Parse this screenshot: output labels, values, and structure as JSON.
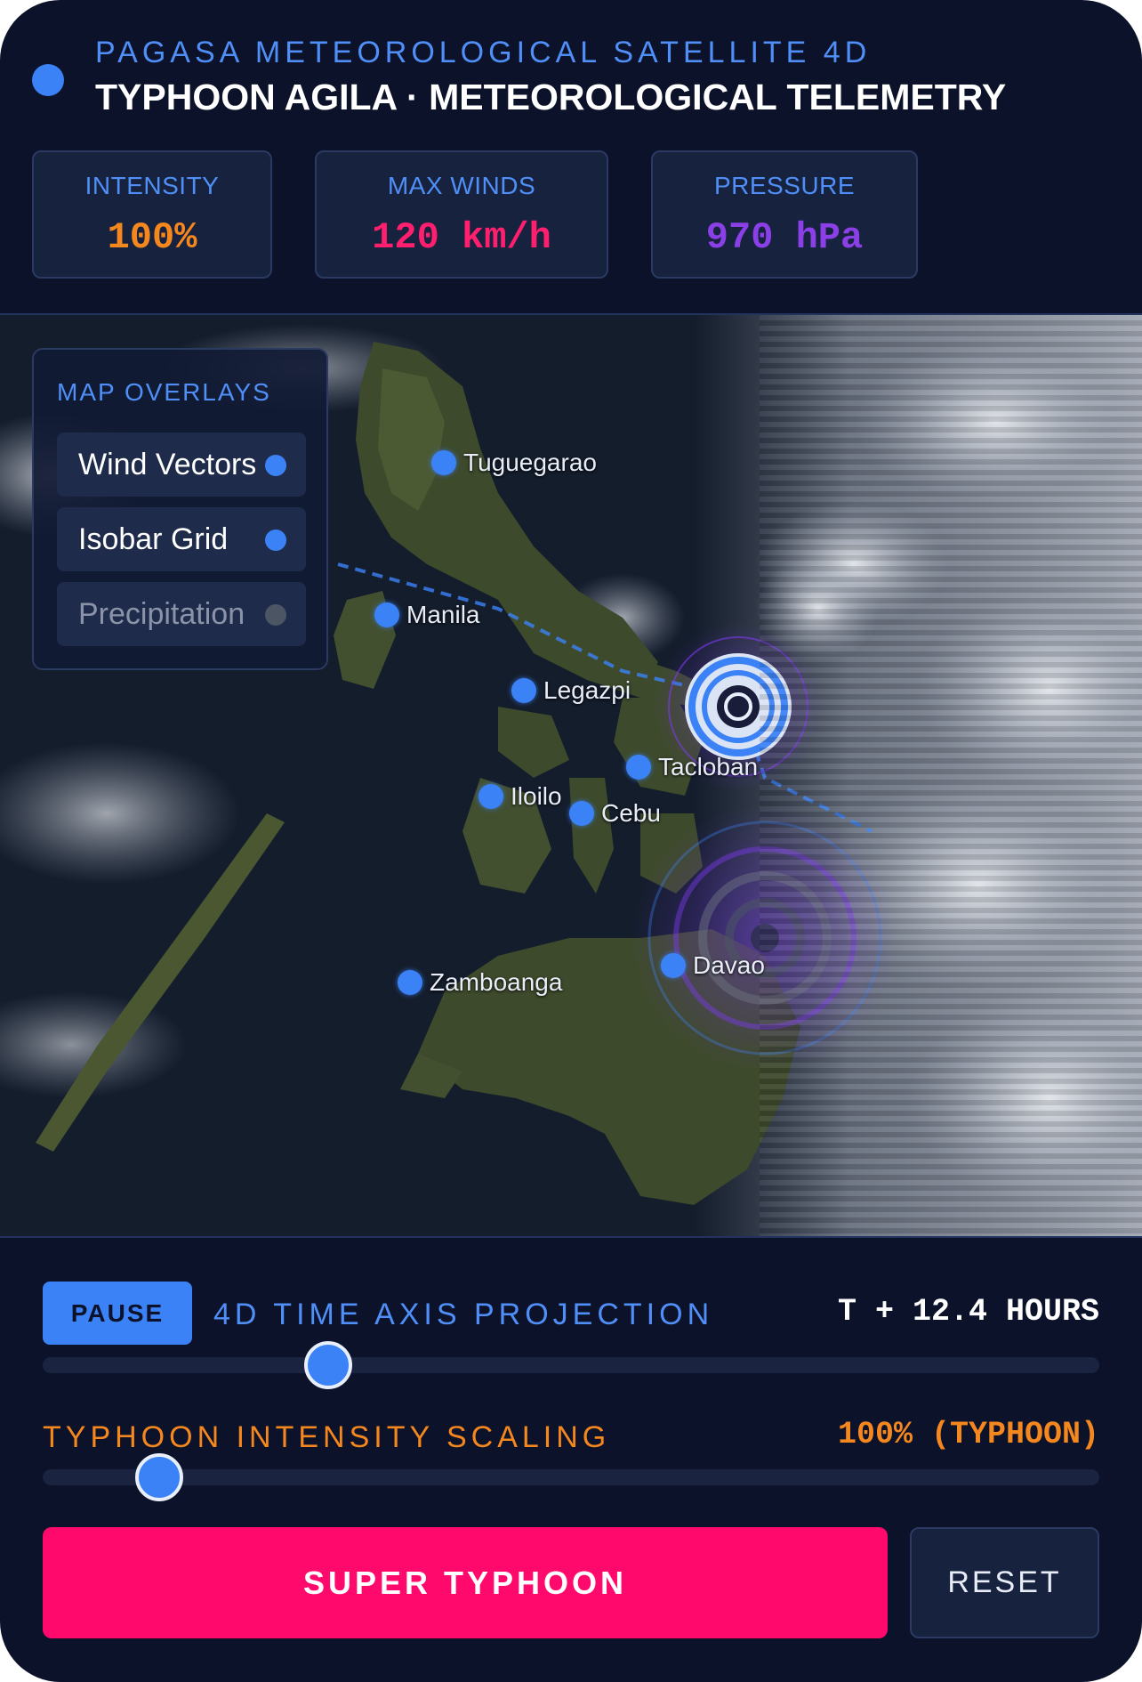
{
  "header": {
    "subtitle": "PAGASA METEOROLOGICAL SATELLITE 4D",
    "title": "TYPHOON AGILA · METEOROLOGICAL TELEMETRY"
  },
  "stats": [
    {
      "label": "INTENSITY",
      "value": "100%",
      "color": "#f5871f"
    },
    {
      "label": "MAX WINDS",
      "value": "120 km/h",
      "color": "#ff1f6e"
    },
    {
      "label": "PRESSURE",
      "value": "970 hPa",
      "color": "#8b3fe6"
    }
  ],
  "map": {
    "cities": [
      "Tuguegarao",
      "Manila",
      "Legazpi",
      "Tacloban",
      "Iloilo",
      "Cebu",
      "Davao",
      "Zamboanga"
    ],
    "overlays": {
      "title": "MAP OVERLAYS",
      "items": [
        {
          "label": "Wind Vectors",
          "active": true
        },
        {
          "label": "Isobar Grid",
          "active": true
        },
        {
          "label": "Precipitation",
          "active": false
        }
      ]
    }
  },
  "controls": {
    "pause_label": "PAUSE",
    "time_label": "4D TIME AXIS PROJECTION",
    "time_value": "T + 12.4 HOURS",
    "time_progress": 0.27,
    "intensity_label": "TYPHOON INTENSITY SCALING",
    "intensity_value": "100% (TYPHOON)",
    "intensity_progress": 0.11,
    "super_label": "SUPER TYPHOON",
    "reset_label": "RESET"
  },
  "colors": {
    "accent": "#3b82f6",
    "warning": "#f5871f",
    "danger": "#ff0a6c",
    "background": "#0b1229"
  }
}
